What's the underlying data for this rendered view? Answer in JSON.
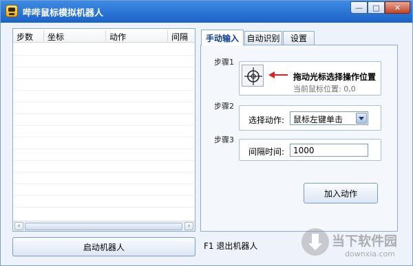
{
  "window": {
    "title": "哔哔鼠标模拟机器人",
    "app_icon": "robot-face-icon"
  },
  "title_buttons": {
    "minimize": "—",
    "maximize": "□",
    "close": "✕"
  },
  "list": {
    "columns": [
      "步数",
      "坐标",
      "动作",
      "间隔"
    ],
    "rows": []
  },
  "scrollbar": {
    "left_arrow": "‹",
    "right_arrow": "›"
  },
  "start_button": "启动机器人",
  "hint": "F1  退出机器人",
  "tabs": [
    {
      "label": "手动输入",
      "active": true
    },
    {
      "label": "自动识别",
      "active": false
    },
    {
      "label": "设置",
      "active": false
    }
  ],
  "steps": {
    "step1": {
      "label": "步骤1",
      "drag_text": "拖动光标选择操作位置",
      "position_text": "当前鼠标位置: 0,0",
      "icon": "crosshair-icon"
    },
    "step2": {
      "label": "步骤2",
      "action_label": "选择动作:",
      "action_value": "鼠标左键单击"
    },
    "step3": {
      "label": "步骤3",
      "interval_label": "间隔时间:",
      "interval_value": "1000"
    }
  },
  "add_button": "加入动作",
  "watermark": {
    "cn": "当下软件园",
    "en": "downxia.com"
  },
  "colors": {
    "titlebar": "#1b62c7",
    "accent_arrow": "#e02020",
    "active_tab_text": "#0a3d91"
  }
}
